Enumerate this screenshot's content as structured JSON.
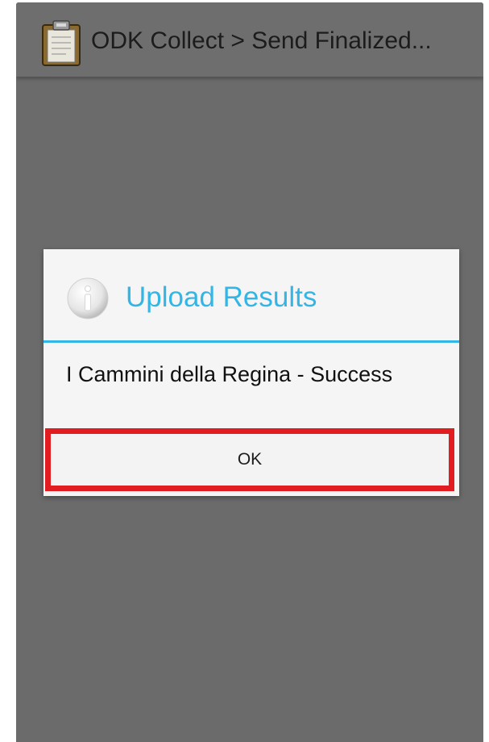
{
  "action_bar": {
    "icon": "clipboard-icon",
    "title": "ODK Collect > Send Finalized..."
  },
  "dialog": {
    "icon": "info-icon",
    "title": "Upload Results",
    "message": "I Cammini della Regina - Success",
    "ok_label": "OK"
  },
  "colors": {
    "accent": "#33b5e5",
    "highlight_border": "#e21d22",
    "background": "#6b6b6b",
    "dialog_background": "#f5f5f5"
  }
}
